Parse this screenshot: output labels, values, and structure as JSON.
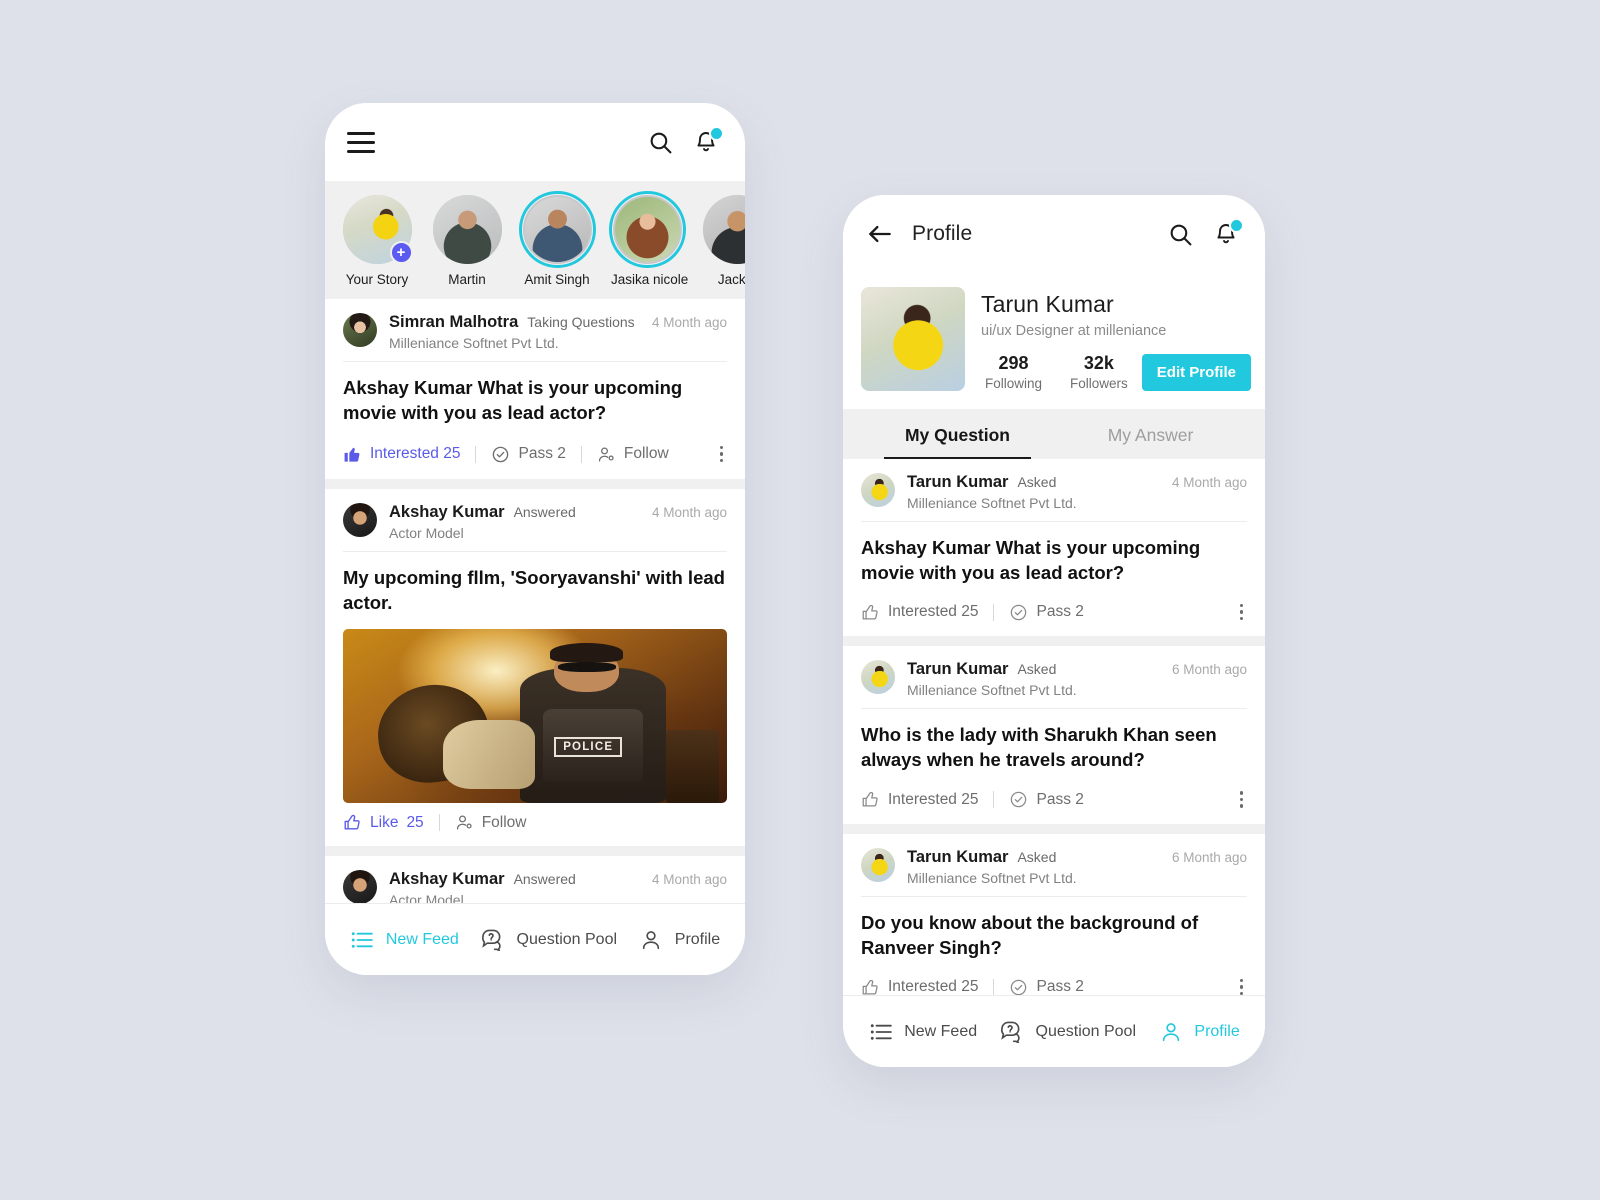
{
  "background_color": "#dee1e9",
  "accent_cyan": "#22c8dd",
  "accent_indigo": "#5a5ae8",
  "feed_screen": {
    "topbar": {
      "menu_icon": "hamburger-icon",
      "search_icon": "search-icon",
      "notification_icon": "bell-icon",
      "has_notification_dot": true
    },
    "stories": [
      {
        "name": "Your Story",
        "ring": false,
        "add_badge": "+",
        "avatar": "av-you"
      },
      {
        "name": "Martin",
        "ring": false,
        "avatar": "av-martin"
      },
      {
        "name": "Amit Singh",
        "ring": true,
        "avatar": "av-amit"
      },
      {
        "name": "Jasika nicole",
        "ring": true,
        "avatar": "av-jasika"
      },
      {
        "name": "Jackie",
        "ring": false,
        "avatar": "av-jackie"
      }
    ],
    "question_post": {
      "author": "Simran Malhotra",
      "action_tag": "Taking Questions",
      "timeago": "4 Month ago",
      "subtitle": "Milleniance Softnet Pvt Ltd.",
      "title": "Akshay Kumar What is your upcoming movie with you as lead actor?",
      "actions": {
        "interested_label": "Interested 25",
        "pass_label": "Pass 2",
        "follow_label": "Follow"
      }
    },
    "answer_post": {
      "author": "Akshay Kumar",
      "action_tag": "Answered",
      "timeago": "4 Month ago",
      "subtitle": "Actor Model",
      "title": "My upcoming fllm, 'Sooryavanshi' with lead actor.",
      "image_caption": "POLICE",
      "actions": {
        "like_label": "Like",
        "like_count": "25",
        "follow_label": "Follow"
      }
    },
    "answer_post_2": {
      "author": "Akshay Kumar",
      "action_tag": "Answered",
      "timeago": "4 Month ago",
      "subtitle": "Actor Model"
    },
    "bottom_nav": [
      {
        "label": "New Feed",
        "icon": "list-icon",
        "active": true
      },
      {
        "label": "Question Pool",
        "icon": "question-bubble-icon",
        "active": false
      },
      {
        "label": "Profile",
        "icon": "person-icon",
        "active": false
      }
    ]
  },
  "profile_screen": {
    "topbar": {
      "back_icon": "back-arrow-icon",
      "title": "Profile",
      "search_icon": "search-icon",
      "notification_icon": "bell-icon",
      "has_notification_dot": true
    },
    "profile": {
      "name": "Tarun Kumar",
      "role": "ui/ux Designer at milleniance",
      "following_count": "298",
      "following_label": "Following",
      "followers_count": "32k",
      "followers_label": "Followers",
      "edit_button": "Edit Profile"
    },
    "tabs": [
      {
        "label": "My Question",
        "active": true
      },
      {
        "label": "My Answer",
        "active": false
      }
    ],
    "questions": [
      {
        "author": "Tarun Kumar",
        "action_tag": "Asked",
        "timeago": "4 Month ago",
        "subtitle": "Milleniance Softnet Pvt Ltd.",
        "title": "Akshay Kumar What is your upcoming movie with you as lead actor?",
        "interested_label": "Interested 25",
        "pass_label": "Pass 2"
      },
      {
        "author": "Tarun Kumar",
        "action_tag": "Asked",
        "timeago": "6 Month ago",
        "subtitle": "Milleniance Softnet Pvt Ltd.",
        "title": "Who is the lady with Sharukh Khan seen always when he travels around?",
        "interested_label": "Interested 25",
        "pass_label": "Pass 2"
      },
      {
        "author": "Tarun Kumar",
        "action_tag": "Asked",
        "timeago": "6 Month ago",
        "subtitle": "Milleniance Softnet Pvt Ltd.",
        "title": "Do you know about the background of Ranveer Singh?",
        "interested_label": "Interested 25",
        "pass_label": "Pass 2"
      }
    ],
    "bottom_nav": [
      {
        "label": "New Feed",
        "icon": "list-icon",
        "active": false
      },
      {
        "label": "Question Pool",
        "icon": "question-bubble-icon",
        "active": false
      },
      {
        "label": "Profile",
        "icon": "person-icon",
        "active": true
      }
    ]
  }
}
